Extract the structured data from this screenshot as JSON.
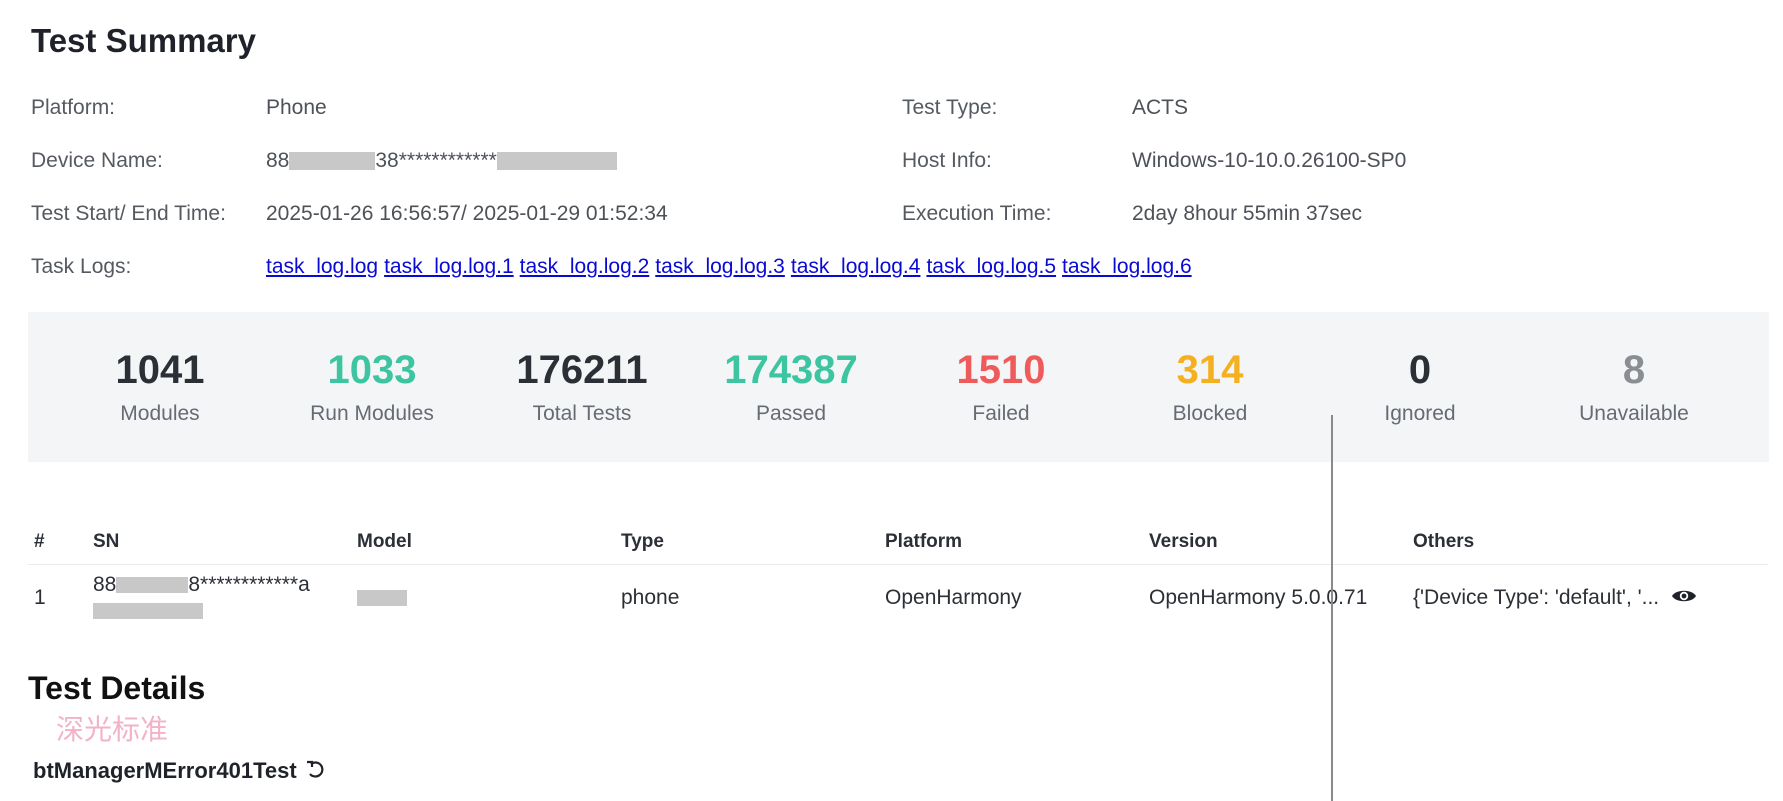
{
  "summary": {
    "title": "Test Summary",
    "platform_label": "Platform:",
    "platform_value": "Phone",
    "test_type_label": "Test Type:",
    "test_type_value": "ACTS",
    "device_name_label": "Device Name:",
    "device_name_prefix": "88",
    "device_name_mid": "38************",
    "host_info_label": "Host Info:",
    "host_info_value": "Windows-10-10.0.26100-SP0",
    "time_label": "Test Start/ End Time:",
    "time_value": "2025-01-26 16:56:57/ 2025-01-29 01:52:34",
    "exec_label": "Execution Time:",
    "exec_value": "2day 8hour 55min 37sec",
    "logs_label": "Task Logs:",
    "logs": [
      "task_log.log",
      "task_log.log.1",
      "task_log.log.2",
      "task_log.log.3",
      "task_log.log.4",
      "task_log.log.5",
      "task_log.log.6"
    ]
  },
  "stats": [
    {
      "value": "1041",
      "label": "Modules",
      "color": "#2b2f36"
    },
    {
      "value": "1033",
      "label": "Run Modules",
      "color": "#3cc5a0"
    },
    {
      "value": "176211",
      "label": "Total Tests",
      "color": "#2b2f36"
    },
    {
      "value": "174387",
      "label": "Passed",
      "color": "#3cc5a0"
    },
    {
      "value": "1510",
      "label": "Failed",
      "color": "#ef5b5b"
    },
    {
      "value": "314",
      "label": "Blocked",
      "color": "#f5b021"
    },
    {
      "value": "0",
      "label": "Ignored",
      "color": "#2b2f36"
    },
    {
      "value": "8",
      "label": "Unavailable",
      "color": "#8a8d92"
    }
  ],
  "devices": {
    "headers": [
      "#",
      "SN",
      "Model",
      "Type",
      "Platform",
      "Version",
      "Others"
    ],
    "rows": [
      {
        "index": "1",
        "sn_prefix": "88",
        "sn_mid": "8************a",
        "type": "phone",
        "platform": "OpenHarmony",
        "version": "OpenHarmony 5.0.0.71",
        "others": "{'Device Type': 'default', '..."
      }
    ]
  },
  "details": {
    "title": "Test Details",
    "watermark": "深光标准",
    "item": "btManagerMError401Test"
  }
}
